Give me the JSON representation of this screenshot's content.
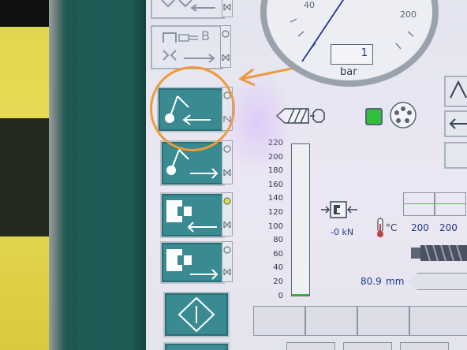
{
  "gauge": {
    "tick_40": "40",
    "tick_200": "200",
    "readout": "1",
    "unit": "bar"
  },
  "bar_scale": {
    "ticks": [
      "220",
      "200",
      "180",
      "160",
      "140",
      "120",
      "100",
      "80",
      "60",
      "40",
      "20",
      "0"
    ]
  },
  "force": {
    "value": "-0 kN"
  },
  "temperature": {
    "unit": "°C",
    "values": [
      "200",
      "200"
    ]
  },
  "position": {
    "value": "80.9",
    "unit": "mm"
  },
  "buttons": {
    "b_label": "B"
  },
  "colors": {
    "highlight": "#ee9a3a",
    "teal": "#3a8a91",
    "green_status": "#2fbf3a",
    "blue_text": "#1f3b8e"
  },
  "icons": [
    "arrow-left-icon",
    "arrow-right-icon",
    "valve-icon",
    "mold-open-icon",
    "mold-close-icon",
    "ejector-icon",
    "nozzle-icon",
    "diamond-icon",
    "thermometer-icon",
    "status-green-icon",
    "screw-icon"
  ]
}
